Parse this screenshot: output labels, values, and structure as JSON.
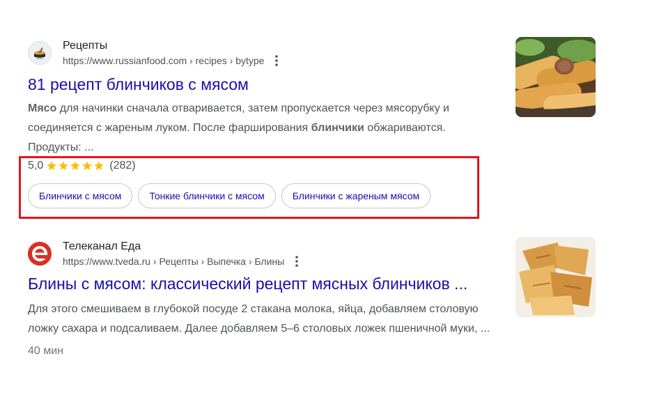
{
  "results": [
    {
      "site_name": "Рецепты",
      "url": "https://www.russianfood.com › recipes › bytype",
      "title": "81 рецепт блинчиков с мясом",
      "snippet": {
        "part1_bold": "Мясо",
        "part2": " для начинки сначала отваривается, затем пропускается через мясорубку и соединяется с жареным луком. После фарширования ",
        "part3_bold": "блинчики",
        "part4": " обжариваются. Продукты: ..."
      },
      "rating": {
        "score": "5,0",
        "stars": 5,
        "count": "(282)"
      },
      "chips": [
        "Блинчики с мясом",
        "Тонкие блинчики с мясом",
        "Блинчики с жареным мясом"
      ],
      "favicon_icon": "cooking-pot-icon",
      "thumbnail_icon": "stuffed-crepes-image"
    },
    {
      "site_name": "Телеканал Еда",
      "url": "https://www.tveda.ru › Рецепты › Выпечка › Блины",
      "title": "Блины с мясом: классический рецепт мясных блинчиков ...",
      "snippet": "Для этого смешиваем в глубокой посуде 2 стакана молока, яйца, добавляем столовую ложку сахара и подсаливаем. Далее добавляем 5–6 столовых ложек пшеничной муки, ...",
      "meta": "40 мин",
      "favicon_letter": "e",
      "favicon_icon": "tveda-logo-icon",
      "thumbnail_icon": "folded-crepes-image"
    }
  ],
  "colors": {
    "link": "#1a0dab",
    "star": "#fbbc04",
    "highlight": "#e0161e",
    "tveda_brand": "#d93025"
  }
}
